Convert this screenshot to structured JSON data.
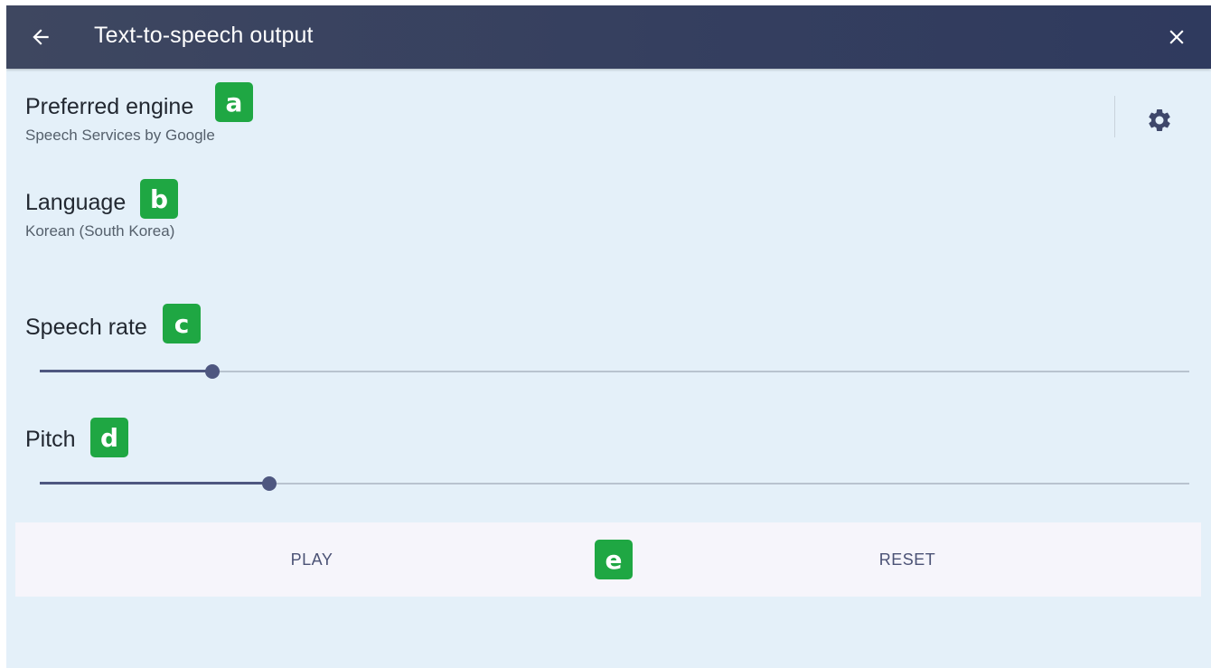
{
  "appbar": {
    "title": "Text-to-speech output",
    "back_icon": "arrow-left-icon",
    "close_icon": "close-icon",
    "background": "#353f5f"
  },
  "preferred_engine": {
    "title": "Preferred engine",
    "value": "Speech Services by Google",
    "badge": "a",
    "settings_icon": "gear-icon"
  },
  "language": {
    "title": "Language",
    "value": "Korean (South Korea)",
    "badge": "b"
  },
  "speech_rate": {
    "title": "Speech rate",
    "badge": "c",
    "level": 0.15
  },
  "pitch": {
    "title": "Pitch",
    "badge": "d",
    "level": 0.2
  },
  "actions": {
    "play_label": "PLAY",
    "reset_label": "RESET",
    "badge": "e"
  },
  "colors": {
    "accent": "#4e5780",
    "badge": "#1fa743",
    "background": "#e4f0f9"
  }
}
